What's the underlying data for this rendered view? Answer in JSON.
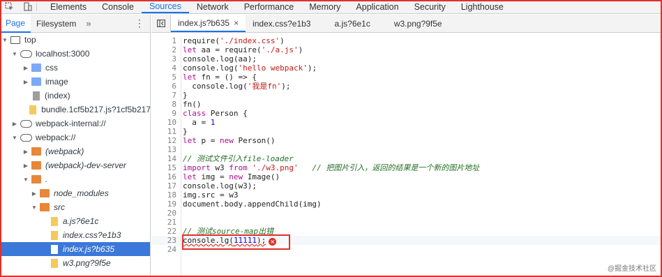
{
  "toolbar": {
    "inspect_icon": "element-picker-icon",
    "device_icon": "device-toolbar-icon"
  },
  "tabs": [
    "Elements",
    "Console",
    "Sources",
    "Network",
    "Performance",
    "Memory",
    "Application",
    "Security",
    "Lighthouse"
  ],
  "active_tab": "Sources",
  "navigator": {
    "tabs": [
      "Page",
      "Filesystem"
    ],
    "more": "»",
    "menu": "⋮",
    "tree": [
      {
        "label": "top",
        "icon": "frame-icon",
        "depth": 0,
        "arrow": "▼"
      },
      {
        "label": "localhost:3000",
        "icon": "cloud-icon",
        "depth": 1,
        "arrow": "▼"
      },
      {
        "label": "css",
        "icon": "folder-icon",
        "depth": 2,
        "arrow": "▶"
      },
      {
        "label": "image",
        "icon": "folder-icon",
        "depth": 2,
        "arrow": "▶"
      },
      {
        "label": "(index)",
        "icon": "file-icon",
        "depth": 2,
        "arrow": ""
      },
      {
        "label": "bundle.1cf5b217.js?1cf5b217",
        "icon": "script-file-icon",
        "depth": 2,
        "arrow": ""
      },
      {
        "label": "webpack-internal://",
        "icon": "cloud-icon",
        "depth": 1,
        "arrow": "▶"
      },
      {
        "label": "webpack://",
        "icon": "cloud-icon",
        "depth": 1,
        "arrow": "▼"
      },
      {
        "label": "(webpack)",
        "icon": "folder-icon",
        "depth": 2,
        "arrow": "▶"
      },
      {
        "label": "(webpack)-dev-server",
        "icon": "folder-icon",
        "depth": 2,
        "arrow": "▶"
      },
      {
        "label": ".",
        "icon": "folder-icon",
        "depth": 2,
        "arrow": "▼"
      },
      {
        "label": "node_modules",
        "icon": "folder-icon",
        "depth": 3,
        "arrow": "▶"
      },
      {
        "label": "src",
        "icon": "folder-icon",
        "depth": 3,
        "arrow": "▼"
      },
      {
        "label": "a.js?6e1c",
        "icon": "script-file-icon",
        "depth": 4,
        "arrow": ""
      },
      {
        "label": "index.css?e1b3",
        "icon": "script-file-icon",
        "depth": 4,
        "arrow": ""
      },
      {
        "label": "index.js?b635",
        "icon": "script-file-icon",
        "depth": 4,
        "arrow": "",
        "selected": true
      },
      {
        "label": "w3.png?9f5e",
        "icon": "script-file-icon",
        "depth": 4,
        "arrow": ""
      }
    ]
  },
  "editor": {
    "tabs": [
      {
        "label": "index.js?b635",
        "close": "×"
      },
      {
        "label": "index.css?e1b3"
      },
      {
        "label": "a.js?6e1c"
      },
      {
        "label": "w3.png?9f5e"
      }
    ],
    "lines": [
      "require('./index.css')",
      "let aa = require('./a.js')",
      "console.log(aa);",
      "console.log('hello webpack');",
      "let fn = () => {",
      "  console.log('我是fn');",
      "}",
      "fn()",
      "class Person {",
      "  a = 1",
      "}",
      "let p = new Person()",
      "",
      "// 测试文件引入file-loader",
      "import w3 from './w3.png'   // 把图片引入，返回的结果是一个新的图片地址",
      "let img = new Image()",
      "console.log(w3);",
      "img.src = w3",
      "document.body.appendChild(img)",
      "",
      "",
      "// 测试source-map出错",
      "console.lg(11111);",
      ""
    ],
    "error_line": 23,
    "error_icon": "error-icon"
  },
  "watermark": "@掘金技术社区"
}
